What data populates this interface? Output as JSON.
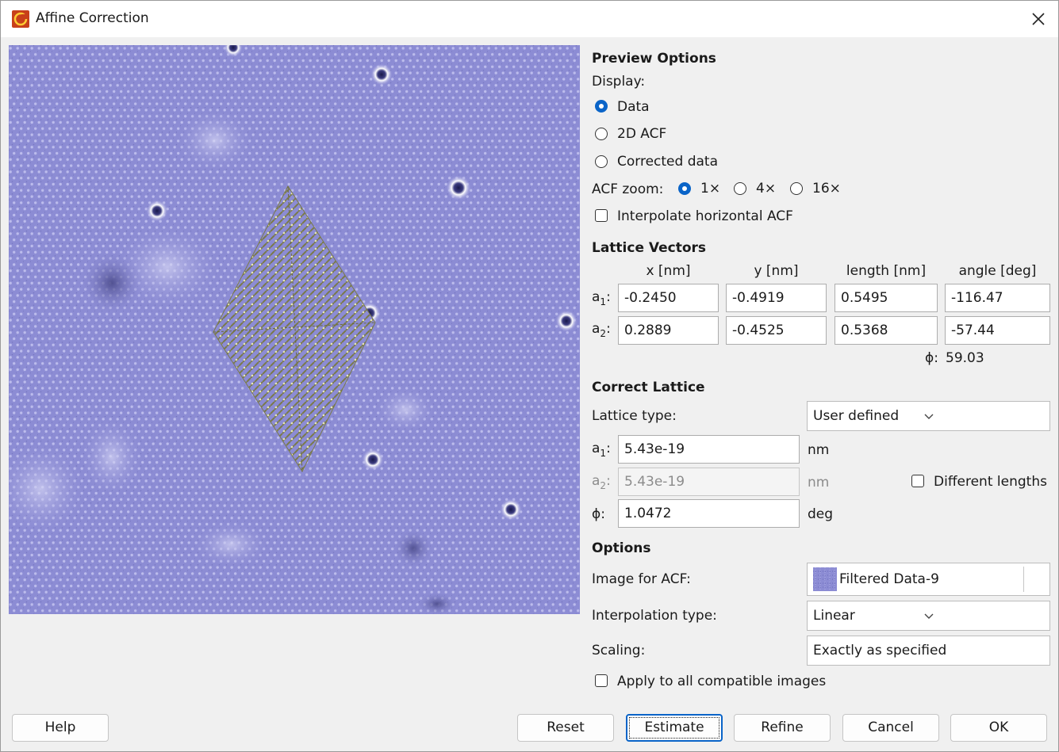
{
  "window": {
    "title": "Affine Correction"
  },
  "preview_options": {
    "heading": "Preview Options",
    "display_label": "Display:",
    "display_options": [
      "Data",
      "2D ACF",
      "Corrected data"
    ],
    "display_selected": "Data",
    "acf_zoom_label": "ACF zoom:",
    "acf_zoom_options": [
      "1×",
      "4×",
      "16×"
    ],
    "acf_zoom_selected": "1×",
    "interpolate_label": "Interpolate horizontal ACF",
    "interpolate_checked": false
  },
  "lattice_vectors": {
    "heading": "Lattice Vectors",
    "columns": [
      "x [nm]",
      "y [nm]",
      "length [nm]",
      "angle [deg]"
    ],
    "rows": [
      {
        "label": "a",
        "sub": "1",
        "suffix": ":",
        "values": [
          "-0.2450",
          "-0.4919",
          "0.5495",
          "-116.47"
        ]
      },
      {
        "label": "a",
        "sub": "2",
        "suffix": ":",
        "values": [
          "0.2889",
          "-0.4525",
          "0.5368",
          "-57.44"
        ]
      }
    ],
    "phi_label": "ϕ:",
    "phi_value": "59.03"
  },
  "correct_lattice": {
    "heading": "Correct Lattice",
    "lattice_type_label": "Lattice type:",
    "lattice_type_value": "User defined",
    "a1_label": "a",
    "a1_sub": "1",
    "a1_suffix": ":",
    "a1_value": "5.43e-19",
    "a1_unit": "nm",
    "a2_label": "a",
    "a2_sub": "2",
    "a2_suffix": ":",
    "a2_value": "5.43e-19",
    "a2_unit": "nm",
    "a2_enabled": false,
    "different_lengths_label": "Different lengths",
    "different_lengths_checked": false,
    "phi_label": "ϕ:",
    "phi_value": "1.0472",
    "phi_unit": "deg"
  },
  "options": {
    "heading": "Options",
    "image_for_acf_label": "Image for ACF:",
    "image_for_acf_value": "Filtered Data-9",
    "interpolation_label": "Interpolation type:",
    "interpolation_value": "Linear",
    "scaling_label": "Scaling:",
    "scaling_value": "Exactly as specified",
    "apply_all_label": "Apply to all compatible images",
    "apply_all_checked": false
  },
  "buttons": {
    "help": "Help",
    "reset": "Reset",
    "estimate": "Estimate",
    "refine": "Refine",
    "cancel": "Cancel",
    "ok": "OK"
  },
  "colors": {
    "accent": "#0a64c8",
    "image_base": "#8c8cd4",
    "lattice_overlay": "#7a7a4a"
  },
  "icons": {
    "app": "gwyddion-app-icon",
    "close": "close-icon",
    "dropdown": "chevron-down-icon",
    "thumbnail": "data-thumbnail-icon"
  }
}
